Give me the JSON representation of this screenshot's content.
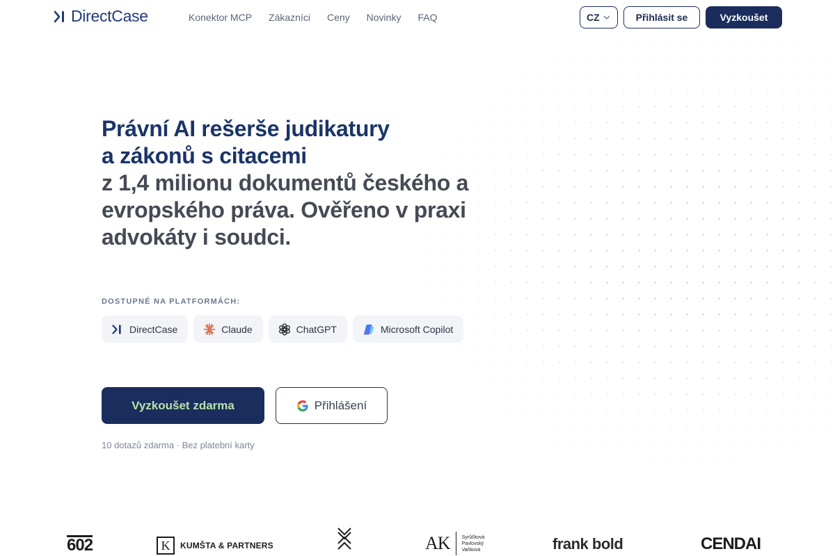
{
  "header": {
    "logo_text": "DirectCase",
    "nav": [
      {
        "label": "Konektor MCP"
      },
      {
        "label": "Zákazníci"
      },
      {
        "label": "Ceny"
      },
      {
        "label": "Novinky"
      },
      {
        "label": "FAQ"
      }
    ],
    "language": "CZ",
    "login_label": "Přihlásit se",
    "try_label": "Vyzkoušet"
  },
  "hero": {
    "title_line1": "Právní AI rešerše judikatury",
    "title_line2": "a zákonů s citacemi",
    "title_rest": "z 1,4 milionu dokumentů českého a evropského práva. Ověřeno v praxi advokáty i soudci."
  },
  "platforms": {
    "label": "DOSTUPNÉ NA PLATFORMÁCH:",
    "items": [
      {
        "label": "DirectCase",
        "icon": "directcase-icon"
      },
      {
        "label": "Claude",
        "icon": "claude-icon"
      },
      {
        "label": "ChatGPT",
        "icon": "chatgpt-icon"
      },
      {
        "label": "Microsoft Copilot",
        "icon": "copilot-icon"
      }
    ]
  },
  "cta": {
    "primary_label": "Vyzkoušet zdarma",
    "secondary_label": "Přihlášení",
    "note": "10 dotazů zdarma · Bez platební karty"
  },
  "customer_logos": {
    "logo_602": "602",
    "kumsta_letter": "K",
    "kumsta_text": "KUMŠTA & PARTNERS",
    "ak_text": "AK",
    "ak_names": [
      "Syrůčková",
      "Pavlovský",
      "Vaňková"
    ],
    "frank_bold": "frank bold",
    "cendai": "CENDAI"
  },
  "colors": {
    "navy": "#1a2d5c",
    "cta_text": "#b8e3a8",
    "heading_blue": "#1b3468",
    "heading_gray": "#454a55"
  }
}
